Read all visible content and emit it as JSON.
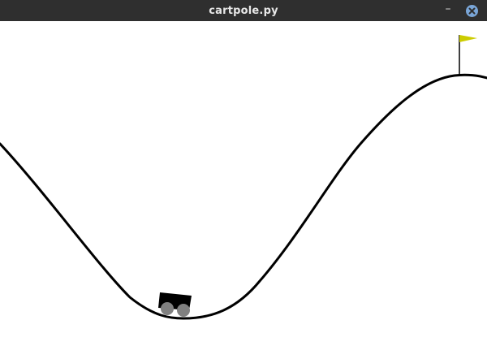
{
  "window": {
    "title": "cartpole.py",
    "minimize_glyph": "–",
    "close_icon": "close-icon",
    "accent": "#7aa6d8"
  },
  "scene": {
    "background": "#ffffff",
    "track_color": "#000000",
    "cart_color": "#000000",
    "wheel_color": "#808080",
    "flag_color": "#cccc00"
  }
}
